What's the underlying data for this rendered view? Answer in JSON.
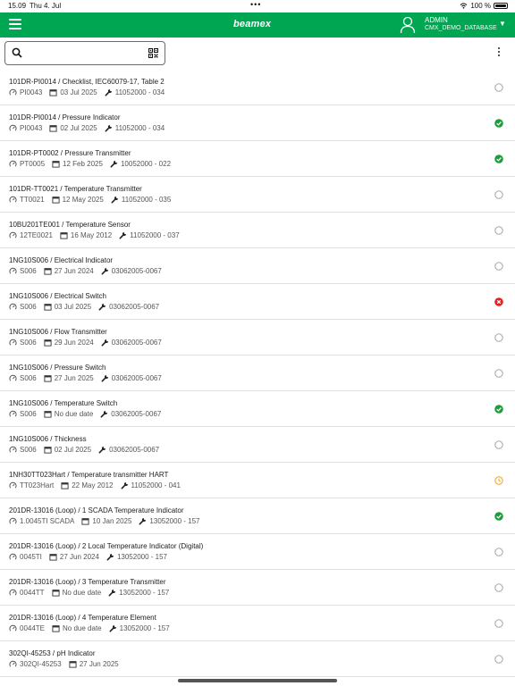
{
  "status_bar": {
    "time": "15.09",
    "date": "Thu 4. Jul",
    "dots": "•••",
    "battery": "100 %"
  },
  "header": {
    "logo": "beamex",
    "user_name": "ADMIN",
    "database": "CMX_DEMO_DATABASE",
    "accent_color": "#00a651"
  },
  "search": {
    "placeholder": "",
    "value": ""
  },
  "items": [
    {
      "title": "101DR-PI0014 / Checklist, IEC60079-17, Table 2",
      "position": "PI0043",
      "date": "03 Jul 2025",
      "device": "11052000 - 034",
      "status": "open"
    },
    {
      "title": "101DR-PI0014 / Pressure Indicator",
      "position": "PI0043",
      "date": "02 Jul 2025",
      "device": "11052000 - 034",
      "status": "passed"
    },
    {
      "title": "101DR-PT0002 / Pressure Transmitter",
      "position": "PT0005",
      "date": "12 Feb 2025",
      "device": "10052000 - 022",
      "status": "passed"
    },
    {
      "title": "101DR-TT0021 / Temperature Transmitter",
      "position": "TT0021",
      "date": "12 May 2025",
      "device": "11052000 - 035",
      "status": "open"
    },
    {
      "title": "10BU201TE001 / Temperature Sensor",
      "position": "12TE0021",
      "date": "16 May 2012",
      "device": "11052000 - 037",
      "status": "open"
    },
    {
      "title": "1NG10S006 / Electrical Indicator",
      "position": "S006",
      "date": "27 Jun 2024",
      "device": "03062005-0067",
      "status": "open"
    },
    {
      "title": "1NG10S006 / Electrical Switch",
      "position": "S006",
      "date": "03 Jul 2025",
      "device": "03062005-0067",
      "status": "failed"
    },
    {
      "title": "1NG10S006 / Flow Transmitter",
      "position": "S006",
      "date": "29 Jun 2024",
      "device": "03062005-0067",
      "status": "open"
    },
    {
      "title": "1NG10S006 / Pressure Switch",
      "position": "S006",
      "date": "27 Jun 2025",
      "device": "03062005-0067",
      "status": "open"
    },
    {
      "title": "1NG10S006 / Temperature Switch",
      "position": "S006",
      "date": "No due date",
      "device": "03062005-0067",
      "status": "passed"
    },
    {
      "title": "1NG10S006 / Thickness",
      "position": "S006",
      "date": "02 Jul 2025",
      "device": "03062005-0067",
      "status": "open"
    },
    {
      "title": "1NH30TT023Hart / Temperature transmitter HART",
      "position": "TT023Hart",
      "date": "22 May 2012",
      "device": "11052000 - 041",
      "status": "pending"
    },
    {
      "title": "201DR-13016 (Loop) / 1 SCADA Temperature Indicator",
      "position": "1.0045TI SCADA",
      "date": "10 Jan 2025",
      "device": "13052000 - 157",
      "status": "passed"
    },
    {
      "title": "201DR-13016 (Loop) / 2 Local Temperature Indicator (Digital)",
      "position": "0045TI",
      "date": "27 Jun 2024",
      "device": "13052000 - 157",
      "status": "open"
    },
    {
      "title": "201DR-13016 (Loop) / 3 Temperature Transmitter",
      "position": "0044TT",
      "date": "No due date",
      "device": "13052000 - 157",
      "status": "open"
    },
    {
      "title": "201DR-13016 (Loop) / 4 Temperature Element",
      "position": "0044TE",
      "date": "No due date",
      "device": "13052000 - 157",
      "status": "open"
    },
    {
      "title": "302QI-45253 / pH Indicator",
      "position": "302QI-45253",
      "date": "27 Jun 2025",
      "device": "",
      "status": "open"
    }
  ],
  "status_colors": {
    "passed": "#1e9e3a",
    "failed": "#e02424",
    "pending": "#f0a020",
    "open": "#9a9a9a"
  }
}
